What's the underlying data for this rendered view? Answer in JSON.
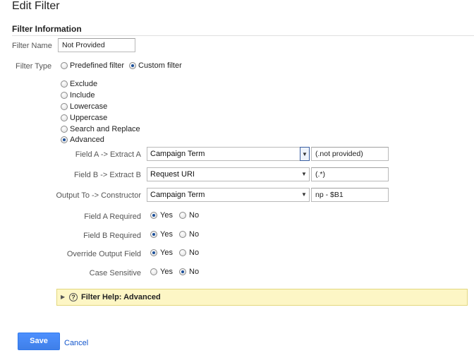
{
  "page": {
    "title": "Edit Filter",
    "section_title": "Filter Information"
  },
  "filter_name": {
    "label": "Filter Name",
    "value": "Not Provided"
  },
  "filter_type": {
    "label": "Filter Type",
    "predefined_label": "Predefined filter",
    "custom_label": "Custom filter",
    "selected": "Custom filter"
  },
  "custom_options": {
    "items": [
      "Exclude",
      "Include",
      "Lowercase",
      "Uppercase",
      "Search and Replace",
      "Advanced"
    ],
    "selected": "Advanced"
  },
  "advanced": {
    "field_a": {
      "label": "Field A -> Extract A",
      "field": "Campaign Term",
      "extract": "(.not provided)"
    },
    "field_b": {
      "label": "Field B -> Extract B",
      "field": "Request URI",
      "extract": "(.*)"
    },
    "output": {
      "label": "Output To -> Constructor",
      "field": "Campaign Term",
      "constructor": "np - $B1"
    }
  },
  "options": {
    "yes_label": "Yes",
    "no_label": "No",
    "rows": [
      {
        "label": "Field A Required",
        "value": "Yes"
      },
      {
        "label": "Field B Required",
        "value": "Yes"
      },
      {
        "label": "Override Output Field",
        "value": "Yes"
      },
      {
        "label": "Case Sensitive",
        "value": "No"
      }
    ]
  },
  "help": {
    "label": "Filter Help: Advanced",
    "icon": "question-circle-icon"
  },
  "actions": {
    "save_label": "Save",
    "cancel_label": "Cancel"
  },
  "colors": {
    "primary_button": "#4d90fe",
    "link": "#1155cc",
    "help_bg": "#fdf6c5"
  }
}
